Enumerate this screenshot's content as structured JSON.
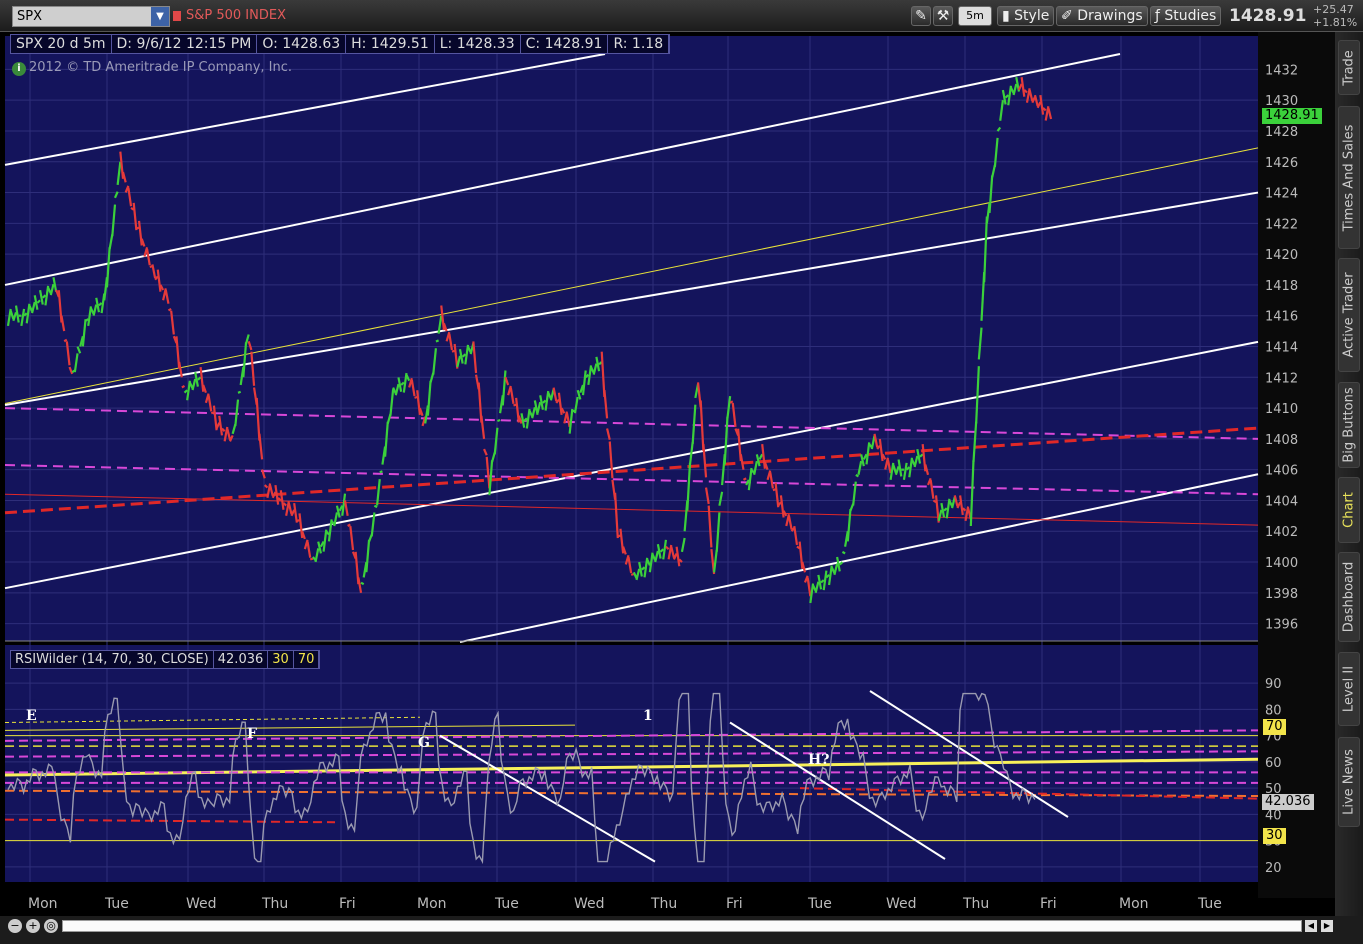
{
  "toolbar": {
    "symbol": "SPX",
    "symbol_description": "S&P 500 INDEX",
    "timeframe": "5m",
    "style_label": "Style",
    "drawings_label": "Drawings",
    "studies_label": "Studies",
    "last_price": "1428.91",
    "net_change": "+25.47",
    "pct_change": "+1.81%"
  },
  "info_bar": {
    "title": "SPX 20 d 5m",
    "date": "D: 9/6/12 12:15 PM",
    "open": "O: 1428.63",
    "high": "H: 1429.51",
    "low": "L: 1428.33",
    "close": "C: 1428.91",
    "range": "R: 1.18"
  },
  "copyright": "2012 © TD Ameritrade IP Company, Inc.",
  "price_badge": "1428.91",
  "rsi": {
    "label": "RSIWilder (14, 70, 30, CLOSE)",
    "value": "42.036",
    "oversold": "30",
    "overbought": "70",
    "badge_value": "42.036",
    "badge_70": "70",
    "badge_30": "30",
    "annotations": [
      "E",
      "F",
      "G",
      "1",
      "H?"
    ]
  },
  "price_axis": [
    "1432",
    "1430",
    "1428",
    "1426",
    "1424",
    "1422",
    "1420",
    "1418",
    "1416",
    "1414",
    "1412",
    "1410",
    "1408",
    "1406",
    "1404",
    "1402",
    "1400",
    "1398",
    "1396"
  ],
  "rsi_axis": [
    "90",
    "80",
    "70",
    "60",
    "50",
    "40",
    "30",
    "20"
  ],
  "time_axis": [
    "Mon",
    "Tue",
    "Wed",
    "Thu",
    "Fri",
    "Mon",
    "Tue",
    "Wed",
    "Thu",
    "Fri",
    "Tue",
    "Wed",
    "Thu",
    "Fri",
    "Mon",
    "Tue"
  ],
  "side_tabs": [
    "Trade",
    "Times And Sales",
    "Active Trader",
    "Big Buttons",
    "Chart",
    "Dashboard",
    "Level II",
    "Live News"
  ],
  "active_tab": "Chart",
  "colors": {
    "plot_bg": "#14145c",
    "grid": "#2e2e7a",
    "up": "#3bd13b",
    "down": "#e53a3a",
    "channel": "#ffffff",
    "magenta": "#d848d8",
    "red_trend": "#e02828",
    "yellow": "#e8e23a",
    "rsi_line": "#9a9ab0"
  },
  "chart_data": {
    "type": "candlestick",
    "symbol": "SPX",
    "ylim": [
      1395,
      1433
    ],
    "rsi_ylim": [
      15,
      95
    ],
    "closes": [
      1416,
      1417,
      1418,
      1412,
      1416,
      1417,
      1426,
      1422,
      1419,
      1417,
      1411,
      1412,
      1409,
      1408,
      1415,
      1405,
      1404,
      1403,
      1400,
      1402,
      1404,
      1398,
      1404,
      1411,
      1412,
      1409,
      1416,
      1413,
      1414,
      1405,
      1412,
      1409,
      1410,
      1411,
      1409,
      1412,
      1413,
      1402,
      1399,
      1400,
      1401,
      1400,
      1412,
      1399,
      1411,
      1405,
      1407,
      1404,
      1402,
      1398,
      1399,
      1400,
      1406,
      1408,
      1406,
      1406,
      1407,
      1403,
      1404,
      1403,
      1422,
      1430,
      1431,
      1430,
      1429
    ]
  }
}
